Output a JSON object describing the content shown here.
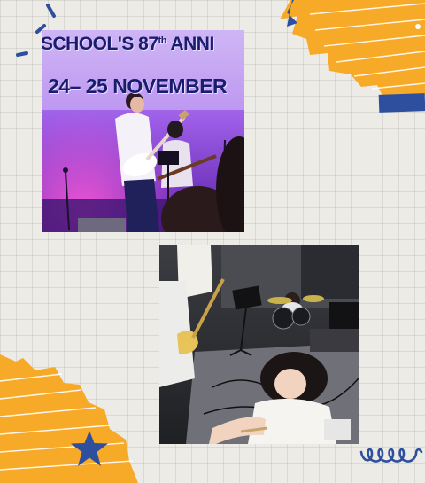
{
  "banner": {
    "line1": "SCHOOL'S 87",
    "line1_suffix": "th",
    "line1_rest": " ANNI",
    "line2": "24– 25 NOVEMBER"
  },
  "colors": {
    "background": "#ecebe6",
    "accent_orange": "#f7a928",
    "accent_blue": "#2e4f9e",
    "stage_purple": "#8d45d8",
    "banner_text": "#1a1c6e"
  },
  "icons": [
    "star-icon",
    "squiggle-icon",
    "slash-icon"
  ]
}
